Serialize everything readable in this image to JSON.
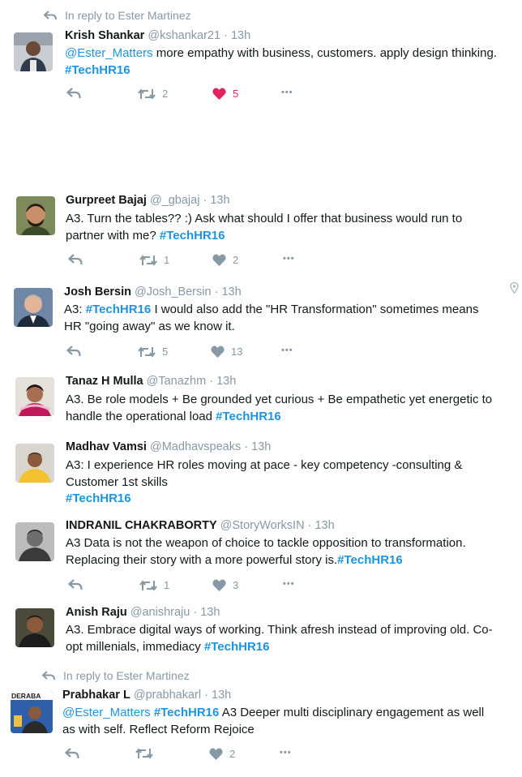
{
  "reply_context_1": "In reply to Ester Martinez",
  "reply_context_2": "In reply to Ester Martinez",
  "tweets": [
    {
      "name": "Krish Shankar",
      "handle": "@kshankar21",
      "time": "13h",
      "text": [
        "@Ester_Matters",
        " more empathy with business, customers. apply design thinking.",
        "#TechHR16"
      ],
      "retweets": "2",
      "likes": "5"
    },
    {
      "name": "Gurpreet Bajaj",
      "handle": "@_gbajaj",
      "time": "13h",
      "text": [
        "A3. Turn the tables?? :) Ask what should I offer that business would run to",
        "partner with me? ",
        "#TechHR16"
      ],
      "retweets": "1",
      "likes": "2"
    },
    {
      "name": "Josh Bersin",
      "handle": "@Josh_Bersin",
      "time": "13h",
      "text": [
        "A3: ",
        "#TechHR16",
        " I would also add the \"HR Transformation\" sometimes means",
        "HR \"going away\" as we know it."
      ],
      "retweets": "5",
      "likes": "13"
    },
    {
      "name": "Tanaz H Mulla",
      "handle": "@Tanazhm",
      "time": "13h",
      "text": [
        "A3. Be role models + Be grounded yet curious + Be empathetic yet energetic to",
        "handle the operational load ",
        "#TechHR16"
      ]
    },
    {
      "name": "Madhav Vamsi",
      "handle": "@Madhavspeaks",
      "time": "13h",
      "text": [
        "A3: I experience HR roles moving at pace  - key competency -consulting &",
        "Customer 1st skills",
        "#TechHR16"
      ]
    },
    {
      "name": "INDRANIL CHAKRABORTY",
      "handle": "@StoryWorksIN",
      "time": "13h",
      "text": [
        "A3 Data is not the weapon of choice to tackle opposition to transformation.",
        "Replacing their story with a more powerful story is.",
        "#TechHR16"
      ],
      "retweets": "1",
      "likes": "3"
    },
    {
      "name": "Anish Raju",
      "handle": "@anishraju",
      "time": "13h",
      "text": [
        "A3. Embrace digital ways of working. Think afresh instead of improving old. Co-",
        "opt millenials, immediacy  ",
        "#TechHR16"
      ]
    },
    {
      "name": "Prabhakar L",
      "handle": "@prabhakarl",
      "time": "13h",
      "text": [
        "@Ester_Matters",
        " ",
        "#TechHR16",
        "  A3 Deeper multi disciplinary engagement as well",
        "as with self. Reflect Reform Rejoice"
      ],
      "likes": "2"
    }
  ],
  "dot": "·",
  "more": "•••",
  "avatar_logo_text": "DERABA",
  "colors": {
    "link": "#1b95e0",
    "muted": "#8899a6",
    "like": "#e0245e",
    "text": "#14171a"
  },
  "icons": [
    "reply-icon",
    "retweet-icon",
    "heart-icon",
    "more-icon",
    "location-pin-icon"
  ]
}
